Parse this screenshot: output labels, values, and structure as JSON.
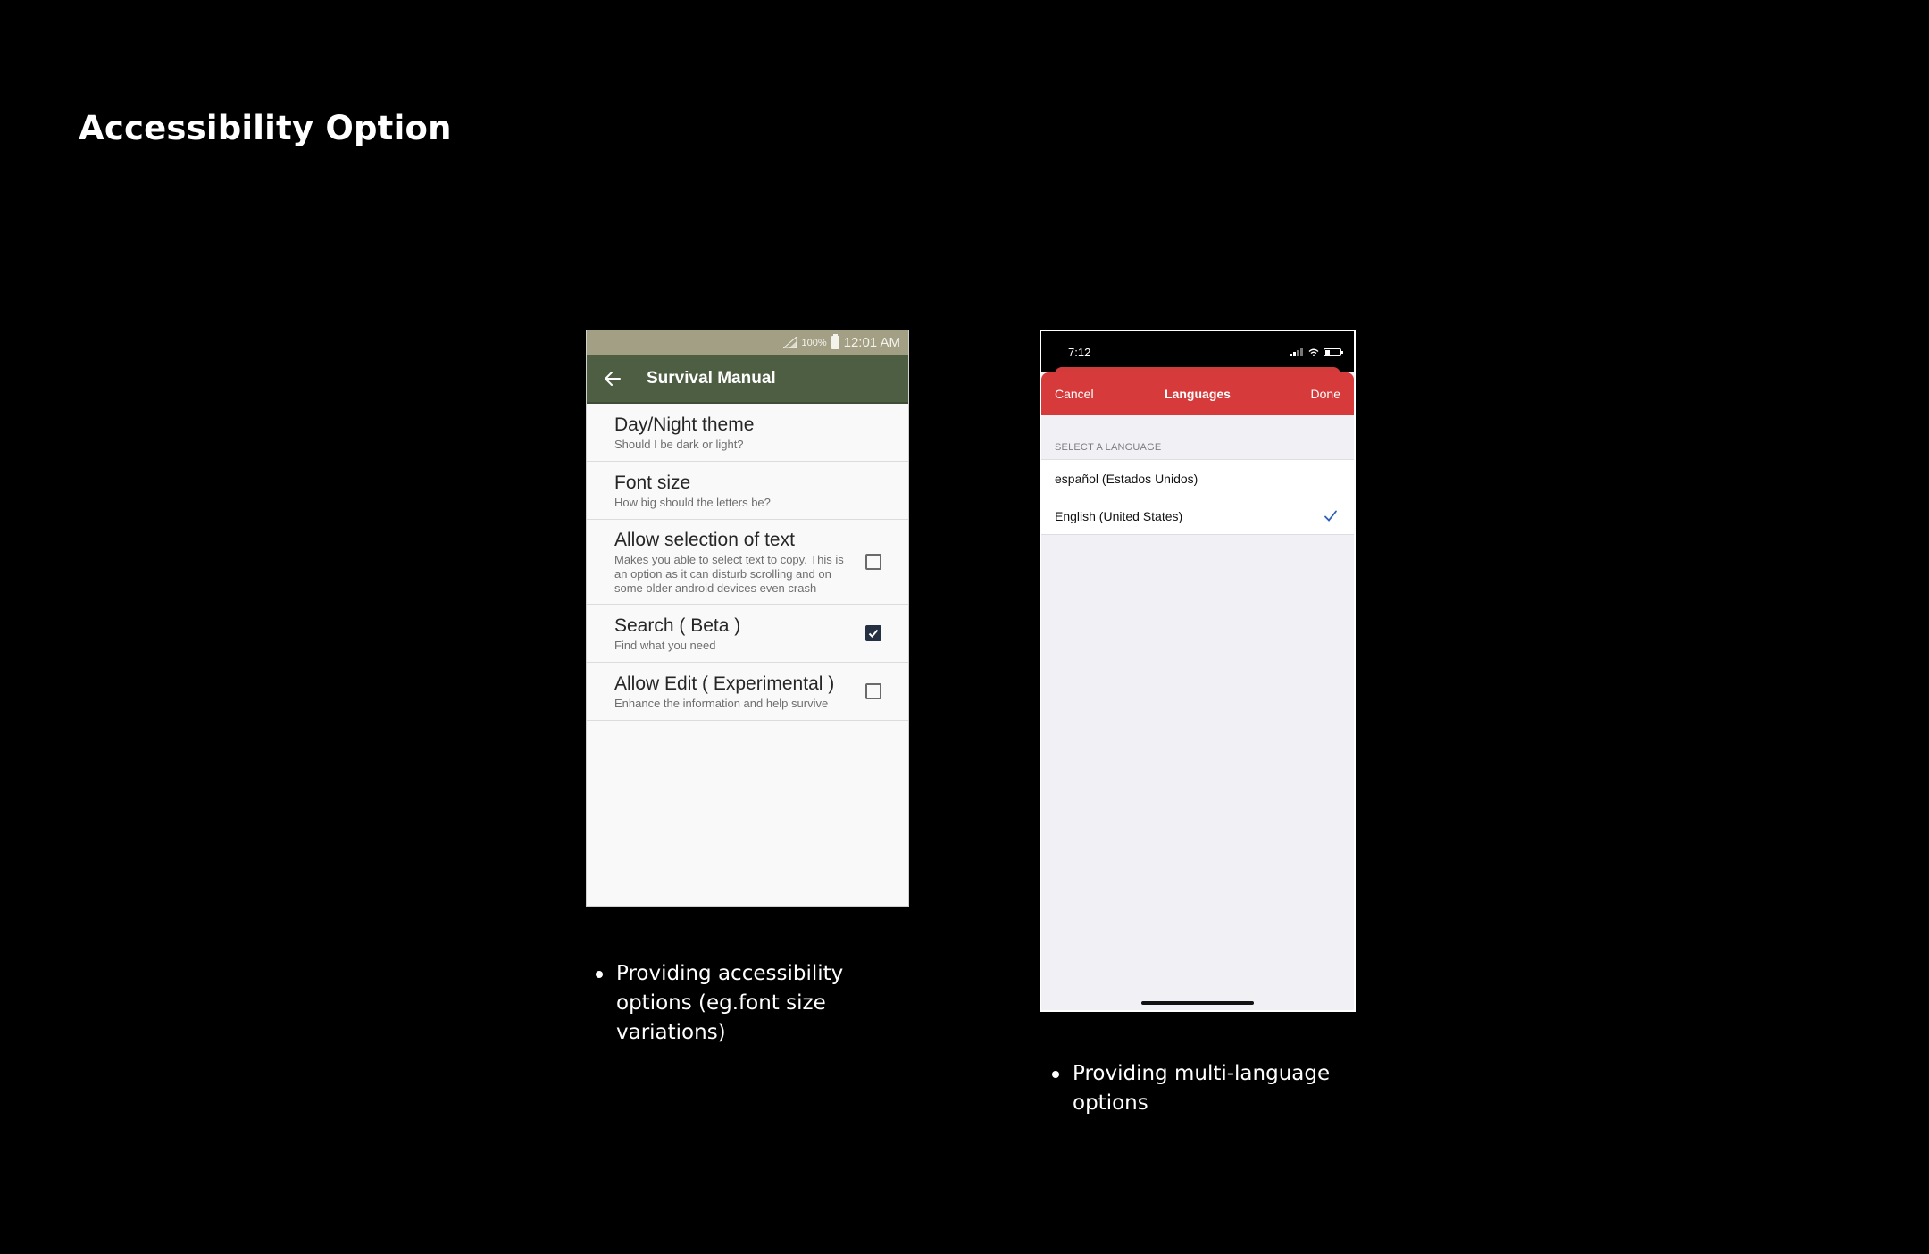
{
  "slide": {
    "title": "Accessibility Option"
  },
  "android": {
    "status": {
      "battery_pct": "100%",
      "time": "12:01 AM"
    },
    "toolbar": {
      "title": "Survival Manual",
      "back_icon": "arrow-left-icon"
    },
    "items": [
      {
        "title": "Day/Night theme",
        "subtitle": "Should I be dark or light?",
        "has_checkbox": false
      },
      {
        "title": "Font size",
        "subtitle": "How big should the letters be?",
        "has_checkbox": false
      },
      {
        "title": "Allow selection of text",
        "subtitle": "Makes you able to select text to copy. This is an option as it can disturb scrolling and on some older android devices even crash",
        "has_checkbox": true,
        "checked": false
      },
      {
        "title": "Search ( Beta )",
        "subtitle": "Find what you need",
        "has_checkbox": true,
        "checked": true
      },
      {
        "title": "Allow Edit ( Experimental )",
        "subtitle": "Enhance the information and help survive",
        "has_checkbox": true,
        "checked": false
      }
    ],
    "colors": {
      "status_bar": "#a39f84",
      "toolbar": "#4d5e42",
      "checkbox_on": "#263043"
    }
  },
  "ios": {
    "status": {
      "time": "7:12"
    },
    "nav": {
      "cancel": "Cancel",
      "title": "Languages",
      "done": "Done"
    },
    "section_header": "SELECT A LANGUAGE",
    "languages": [
      {
        "label": "español (Estados Unidos)",
        "selected": false
      },
      {
        "label": "English (United States)",
        "selected": true
      }
    ],
    "colors": {
      "nav_bar": "#d63a3b",
      "checkmark": "#2c5fb5"
    }
  },
  "captions": {
    "left": "Providing accessibility options (eg.font size variations)",
    "right": "Providing multi-language options"
  }
}
